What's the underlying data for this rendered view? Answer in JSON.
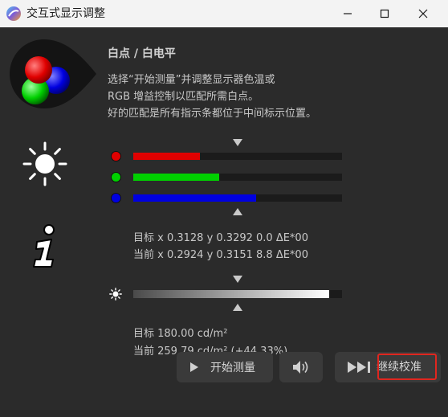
{
  "window": {
    "title": "交互式显示调整",
    "app_icon": "display-calibration-app-icon",
    "controls": [
      "minimize-icon",
      "maximize-icon",
      "close-icon"
    ]
  },
  "panel": {
    "heading": "白点 / 白电平",
    "description": [
      "选择“开始测量”并调整显示器色温或",
      "RGB 增益控制以匹配所需白点。",
      "好的匹配是所有指示条都位于中间标示位置。"
    ],
    "icons": [
      "rgb-circles-icon",
      "brightness-icon",
      "info-icon"
    ]
  },
  "rgb": {
    "channels": [
      {
        "name": "R",
        "color": "#e00000",
        "level": 0.32
      },
      {
        "name": "G",
        "color": "#00d000",
        "level": 0.41
      },
      {
        "name": "B",
        "color": "#0000e0",
        "level": 0.59
      }
    ],
    "target_text": "目标 x 0.3128 y 0.3292 0.0 ΔE*00",
    "current_text": "当前 x 0.2924 y 0.3151 8.8 ΔE*00"
  },
  "luminance": {
    "level": 0.94,
    "target_text": "目标 180.00 cd/m²",
    "current_text": "当前 259.79 cd/m² (+44.33%)"
  },
  "buttons": {
    "measure": {
      "label": "开始测量",
      "icon": "play-icon"
    },
    "sound": {
      "icon": "speaker-icon"
    },
    "continue": {
      "label": "继续校准",
      "icon": "skip-forward-icon"
    }
  },
  "colors": {
    "highlight": "#e0261f",
    "background": "#2b2b2b"
  }
}
